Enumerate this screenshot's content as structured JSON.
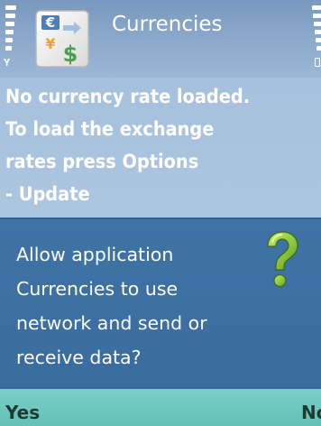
{
  "status_pane": {
    "title": "Currencies",
    "app_icon": "currency-exchange-icon",
    "signal_icon": "signal-strength-icon",
    "battery_icon": "battery-level-icon"
  },
  "main": {
    "empty_message": "No currency rate loaded.\nTo load the exchange\nrates press Options\n- Update"
  },
  "dialog": {
    "message": "Allow application\nCurrencies to use\nnetwork and send or\nreceive data?",
    "icon": "question-mark-icon"
  },
  "softkeys": {
    "left": "Yes",
    "right": "No"
  },
  "colors": {
    "status_bg": "#8ba9cb",
    "main_bg": "#a9c3de",
    "dialog_bg": "#3c6fa3",
    "softkey_bg": "#70c8bf",
    "question_green": "#8cc63f"
  }
}
